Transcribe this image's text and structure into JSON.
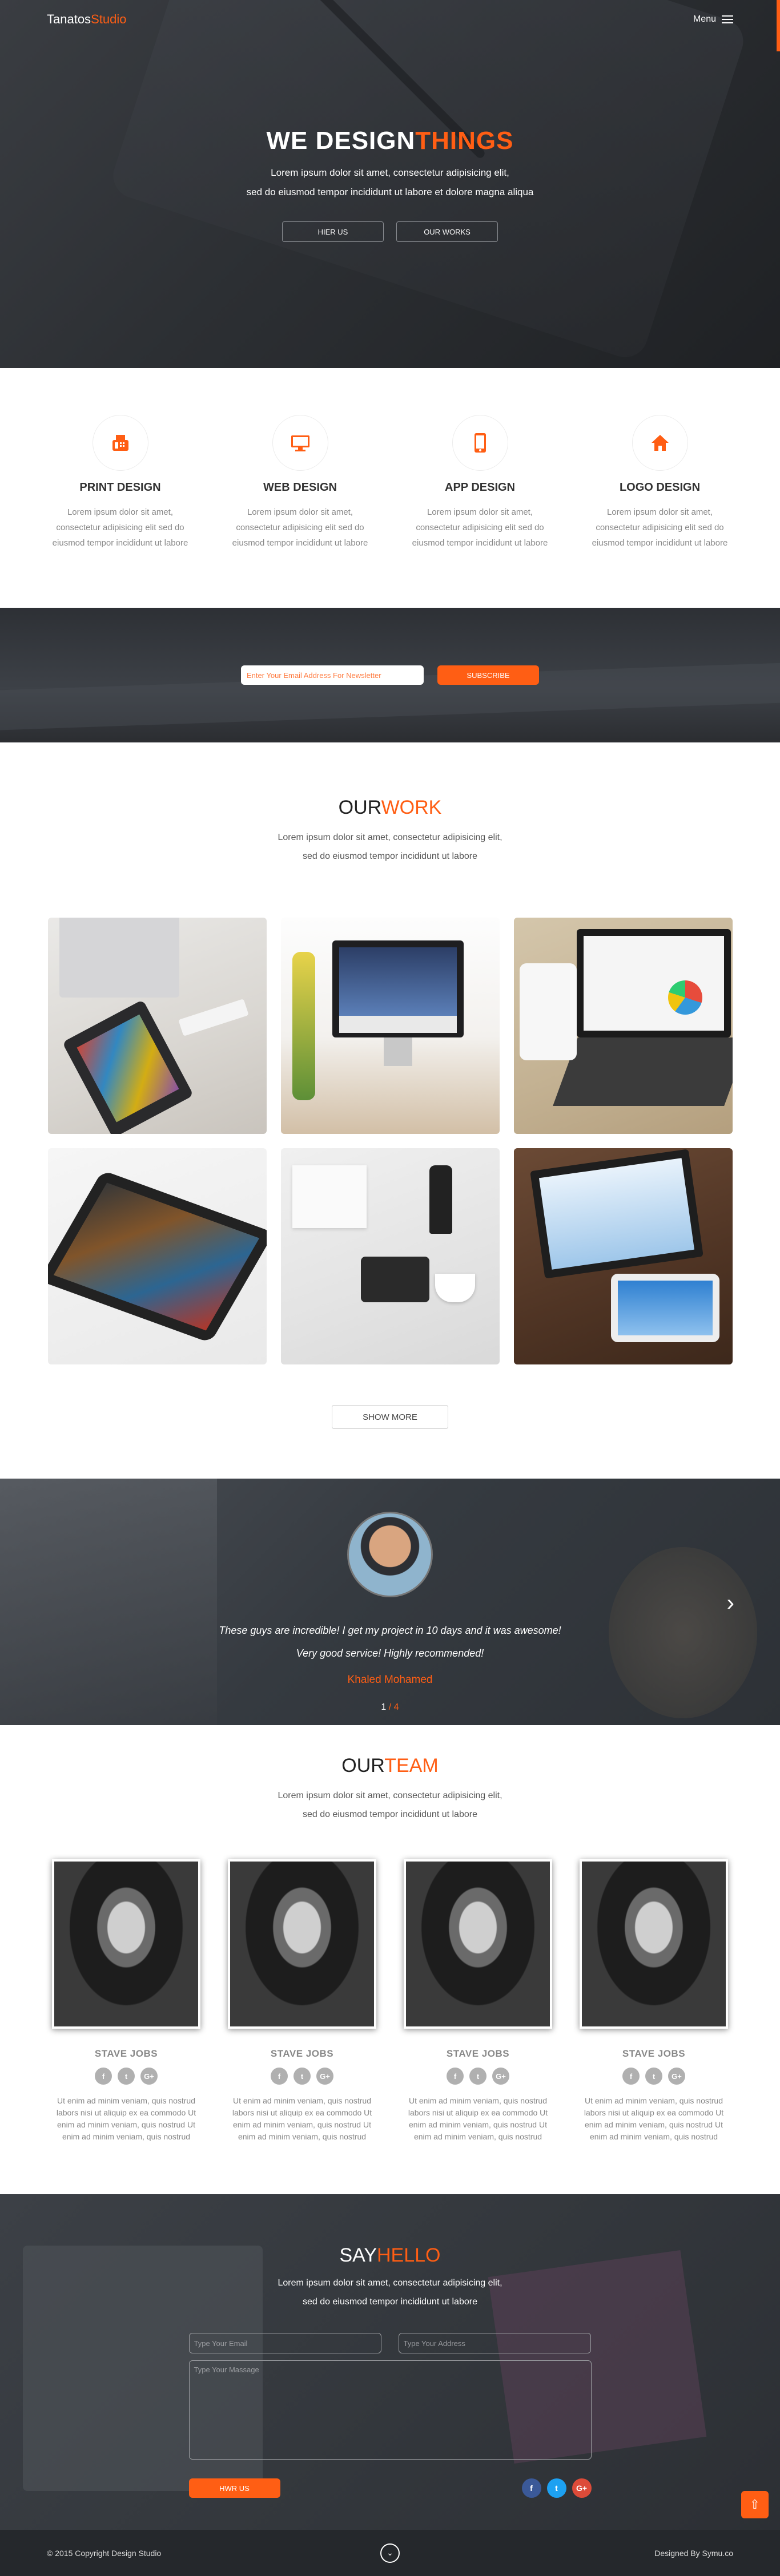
{
  "brand": {
    "part1": "Tanatos",
    "part2": "Studio"
  },
  "nav": {
    "menu_label": "Menu"
  },
  "hero": {
    "title_part1": "WE DESIGN",
    "title_part2": "THINGS",
    "subtitle_line1": "Lorem ipsum dolor sit amet, consectetur adipisicing elit,",
    "subtitle_line2": "sed do eiusmod tempor incididunt ut labore et dolore magna aliqua",
    "btn_hire": "HIER US",
    "btn_works": "OUR WORKS"
  },
  "services": [
    {
      "icon": "fax-icon",
      "title": "PRINT DESIGN",
      "text_line1": "Lorem ipsum dolor sit amet,",
      "text_line2": "consectetur adipisicing elit sed do",
      "text_line3": "eiusmod tempor incididunt ut labore"
    },
    {
      "icon": "monitor-icon",
      "title": "WEB DESIGN",
      "text_line1": "Lorem ipsum dolor sit amet,",
      "text_line2": "consectetur adipisicing elit sed do",
      "text_line3": "eiusmod tempor incididunt ut labore"
    },
    {
      "icon": "mobile-icon",
      "title": "APP DESIGN",
      "text_line1": "Lorem ipsum dolor sit amet,",
      "text_line2": "consectetur adipisicing elit sed do",
      "text_line3": "eiusmod tempor incididunt ut labore"
    },
    {
      "icon": "home-icon",
      "title": "LOGO DESIGN",
      "text_line1": "Lorem ipsum dolor sit amet,",
      "text_line2": "consectetur adipisicing elit sed do",
      "text_line3": "eiusmod tempor incididunt ut labore"
    }
  ],
  "newsletter": {
    "placeholder": "Enter Your Email Address For Newsletter",
    "button": "SUBSCRIBE"
  },
  "work": {
    "title_part1": "OUR",
    "title_part2": "WORK",
    "sub_line1": "Lorem ipsum dolor sit amet, consectetur adipisicing elit,",
    "sub_line2": "sed do eiusmod tempor incididunt ut labore",
    "show_more": "SHOW MORE"
  },
  "testimonial": {
    "quote_line1": "These guys are incredible! I get my project in 10 days and it was awesome!",
    "quote_line2": "Very good service! Highly recommended!",
    "author": "Khaled Mohamed",
    "page_current": "1",
    "page_sep": " / ",
    "page_total": "4"
  },
  "team": {
    "title_part1": "OUR",
    "title_part2": "TEAM",
    "sub_line1": "Lorem ipsum dolor sit amet, consectetur adipisicing elit,",
    "sub_line2": "sed do eiusmod tempor incididunt ut labore",
    "members": [
      {
        "name": "STAVE JOBS",
        "text_line1": "Ut enim ad minim veniam, quis nostrud",
        "text_line2": "labors nisi ut aliquip ex ea commodo Ut",
        "text_line3": "enim ad minim veniam, quis nostrud Ut",
        "text_line4": "enim ad minim veniam, quis nostrud"
      },
      {
        "name": "STAVE JOBS",
        "text_line1": "Ut enim ad minim veniam, quis nostrud",
        "text_line2": "labors nisi ut aliquip ex ea commodo Ut",
        "text_line3": "enim ad minim veniam, quis nostrud Ut",
        "text_line4": "enim ad minim veniam, quis nostrud"
      },
      {
        "name": "STAVE JOBS",
        "text_line1": "Ut enim ad minim veniam, quis nostrud",
        "text_line2": "labors nisi ut aliquip ex ea commodo Ut",
        "text_line3": "enim ad minim veniam, quis nostrud Ut",
        "text_line4": "enim ad minim veniam, quis nostrud"
      },
      {
        "name": "STAVE JOBS",
        "text_line1": "Ut enim ad minim veniam, quis nostrud",
        "text_line2": "labors nisi ut aliquip ex ea commodo Ut",
        "text_line3": "enim ad minim veniam, quis nostrud Ut",
        "text_line4": "enim ad minim veniam, quis nostrud"
      }
    ],
    "social_icons": [
      "f",
      "t",
      "G+"
    ]
  },
  "contact": {
    "title_part1": "SAY",
    "title_part2": "HELLO",
    "sub_line1": "Lorem ipsum dolor sit amet, consectetur adipisicing elit,",
    "sub_line2": "sed do eiusmod tempor incididunt ut labore",
    "email_placeholder": "Type Your Email",
    "address_placeholder": "Type Your Address",
    "message_placeholder": "Type Your Massage",
    "button": "HWR US",
    "social": [
      {
        "label": "f",
        "color": "#3b5998"
      },
      {
        "label": "t",
        "color": "#1da1f2"
      },
      {
        "label": "G+",
        "color": "#dd4b39"
      }
    ]
  },
  "footer": {
    "copyright": "© 2015 Copyright Design Studio",
    "designed_by": "Designed By Symu.co"
  },
  "colors": {
    "accent": "#ff5e14",
    "dark": "#2c2f33"
  }
}
